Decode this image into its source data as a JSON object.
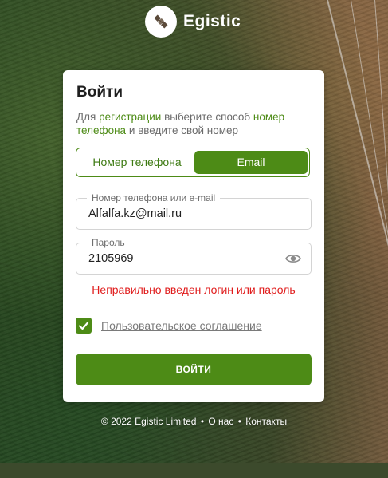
{
  "brand": {
    "name": "Egistic"
  },
  "login": {
    "title": "Войти",
    "subtitle_parts": {
      "p1": "Для ",
      "link_registration": "регистрации",
      "p2": " выберите способ ",
      "link_phone": "номер телефона",
      "p3": " и введите свой номер"
    },
    "tabs": {
      "phone": "Номер телефона",
      "email": "Email",
      "active": "email"
    },
    "login_field": {
      "legend": "Номер телефона или e-mail",
      "value": "Alfalfa.kz@mail.ru"
    },
    "password_field": {
      "legend": "Пароль",
      "value": "2105969"
    },
    "error_message": "Неправильно введен логин или пароль",
    "agreement": {
      "label": "Пользовательское соглашение",
      "checked": true
    },
    "submit_label": "ВОЙТИ"
  },
  "footer": {
    "copyright": "© 2022 Egistic Limited",
    "sep": "•",
    "about": "О нас",
    "contacts": "Контакты"
  },
  "colors": {
    "accent": "#4d8b16",
    "error": "#e01c1c"
  }
}
